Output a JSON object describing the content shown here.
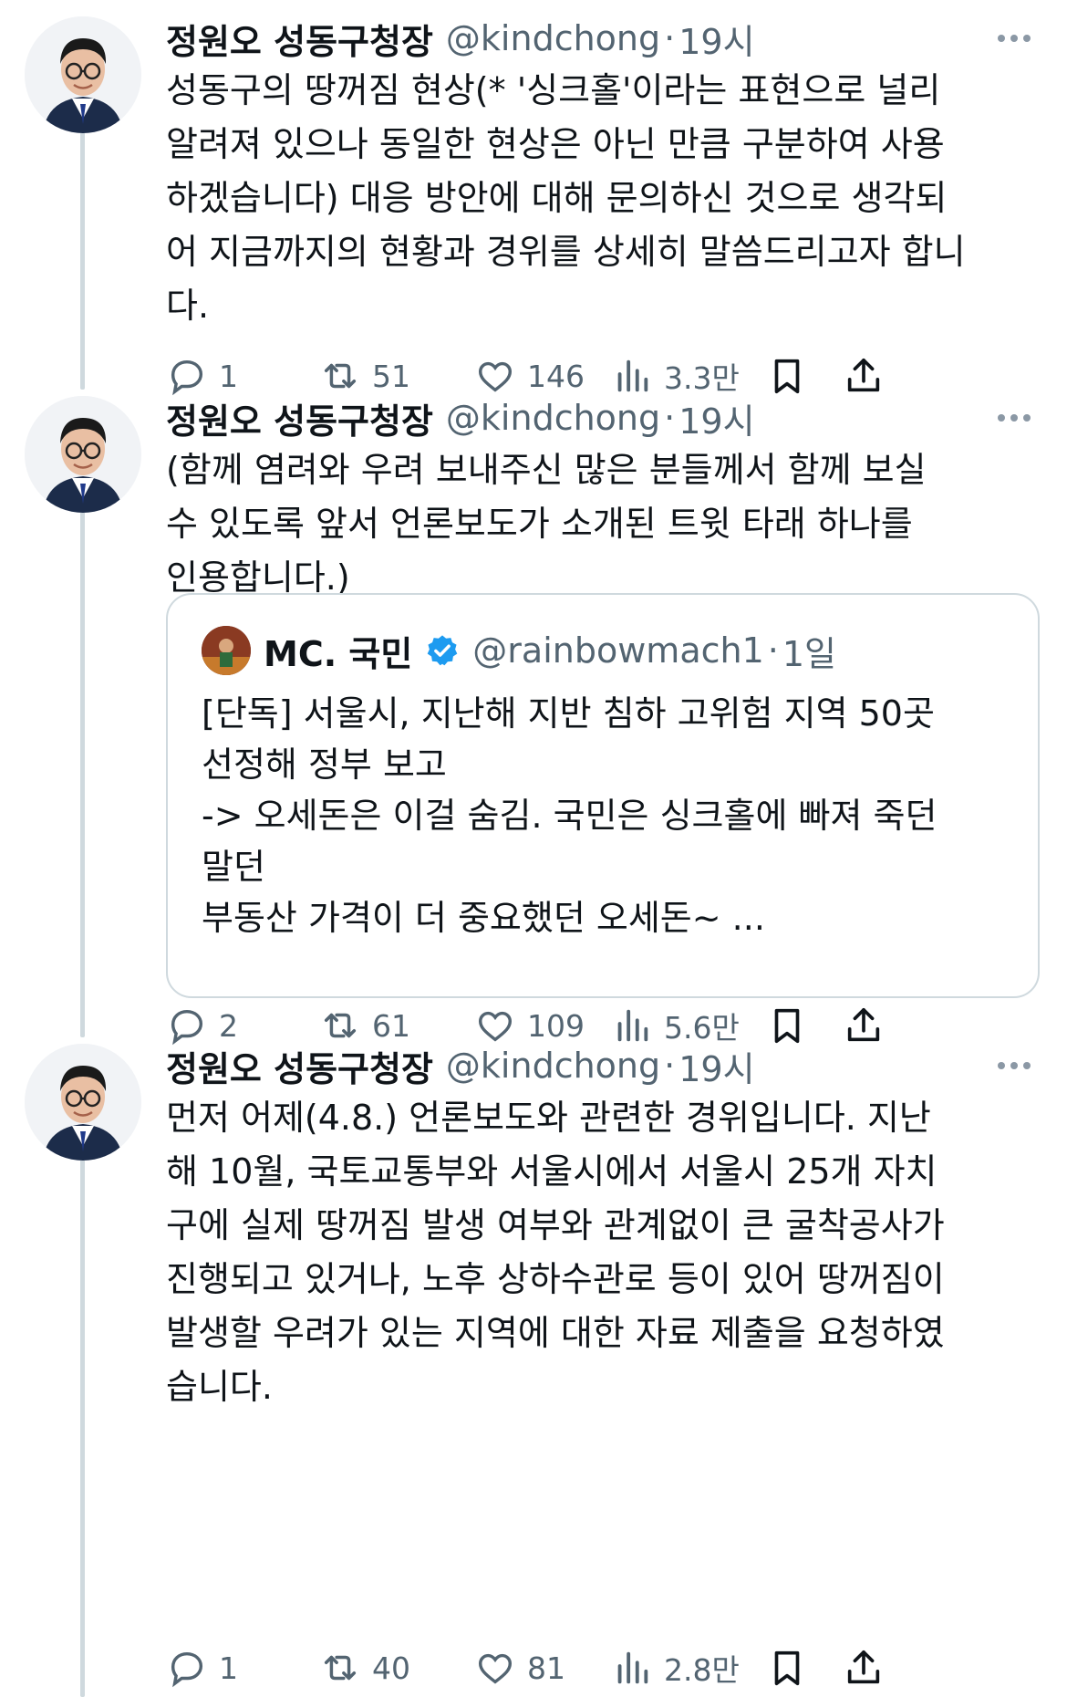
{
  "tweets": [
    {
      "name": "정원오 성동구청장",
      "handle": "@kindchong",
      "separator": "·",
      "time": "19시",
      "text": "성동구의 땅꺼짐 현상(* '싱크홀'이라는 표현으로 널리\n알려져 있으나 동일한 현상은 아닌 만큼 구분하여 사용\n하겠습니다) 대응 방안에 대해 문의하신 것으로 생각되\n어 지금까지의 현황과 경위를 상세히 말씀드리고자 합니\n다.",
      "stats": {
        "replies": "1",
        "retweets": "51",
        "likes": "146",
        "views": "3.3만"
      }
    },
    {
      "name": "정원오 성동구청장",
      "handle": "@kindchong",
      "separator": "·",
      "time": "19시",
      "text": "(함께 염려와 우려 보내주신 많은 분들께서 함께 보실\n수 있도록 앞서 언론보도가 소개된 트윗 타래 하나를\n인용합니다.)",
      "quote": {
        "name": "MC. 국민",
        "handle": "@rainbowmach1",
        "separator": "·",
        "time": "1일",
        "text": "[단독] 서울시, 지난해 지반 침하 고위험 지역 50곳\n선정해 정부 보고\n-> 오세돈은 이걸 숨김. 국민은 싱크홀에 빠져 죽던\n말던\n부동산 가격이 더 중요했던 오세돈~ ..."
      },
      "stats": {
        "replies": "2",
        "retweets": "61",
        "likes": "109",
        "views": "5.6만"
      }
    },
    {
      "name": "정원오 성동구청장",
      "handle": "@kindchong",
      "separator": "·",
      "time": "19시",
      "text": "먼저 어제(4.8.) 언론보도와 관련한 경위입니다. 지난\n해 10월, 국토교통부와 서울시에서 서울시 25개 자치\n구에 실제 땅꺼짐 발생 여부와 관계없이 큰 굴착공사가\n진행되고 있거나, 노후 상하수관로 등이 있어 땅꺼짐이\n발생할 우려가 있는 지역에 대한 자료 제출을 요청하였\n습니다.",
      "stats": {
        "replies": "1",
        "retweets": "40",
        "likes": "81",
        "views": "2.8만"
      }
    }
  ],
  "colors": {
    "text": "#0f1419",
    "muted": "#536471",
    "border": "#cfd9de",
    "verified": "#1d9bf0"
  },
  "icons": [
    "reply-icon",
    "retweet-icon",
    "like-icon",
    "views-icon",
    "bookmark-icon",
    "share-icon",
    "more-icon",
    "verified-icon"
  ]
}
